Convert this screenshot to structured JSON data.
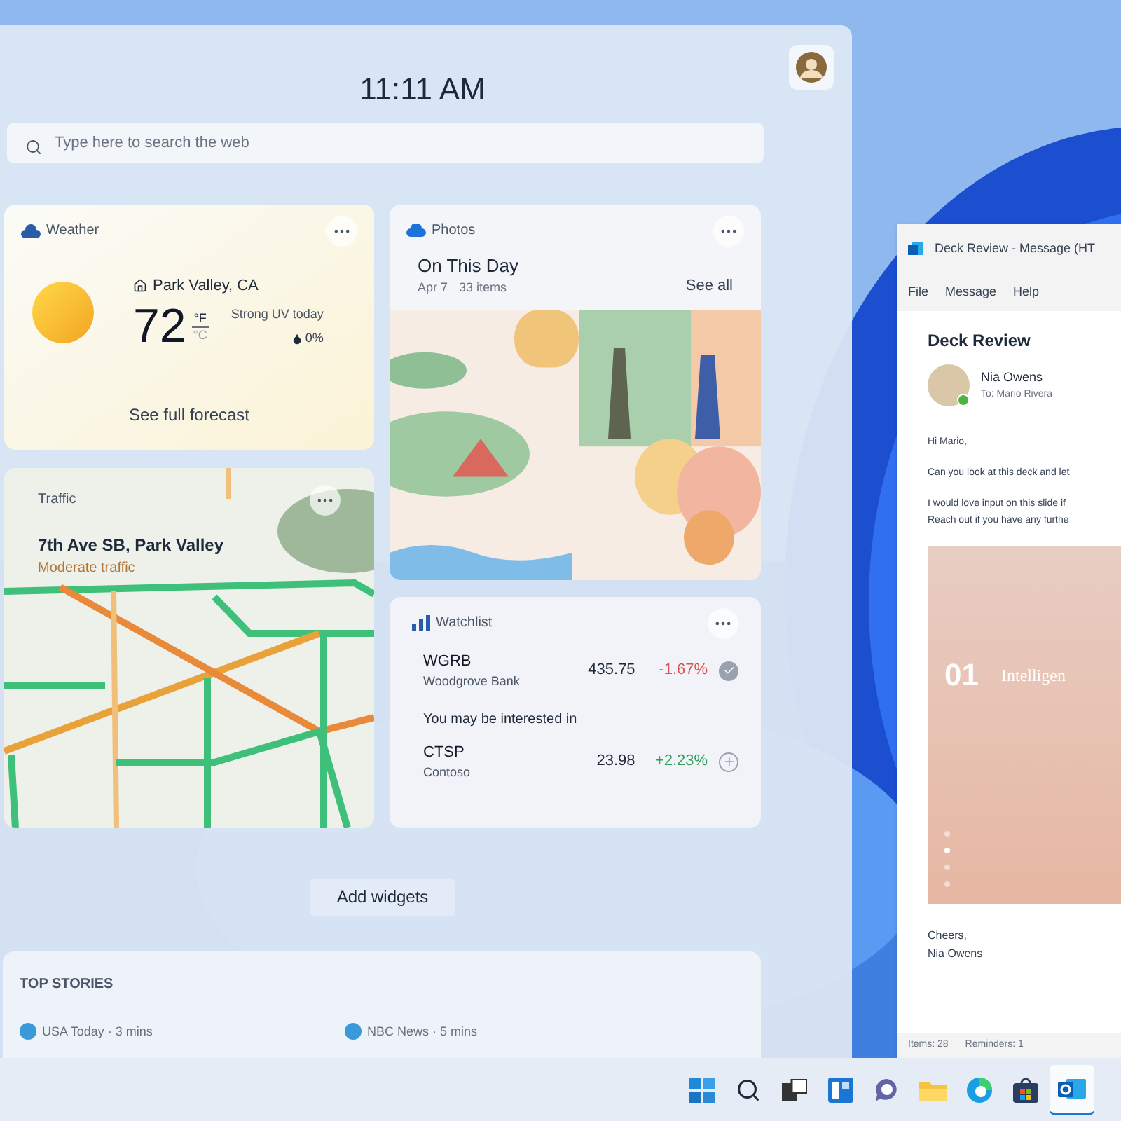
{
  "widgets_panel": {
    "time": "11:11 AM",
    "search": {
      "placeholder": "Type here to search the web"
    },
    "weather": {
      "title": "Weather",
      "location": "Park Valley, CA",
      "temperature": "72",
      "units": [
        {
          "label": "°F",
          "selected": true
        },
        {
          "label": "°C",
          "selected": false
        }
      ],
      "condition": "Strong UV today",
      "precipitation": "0%",
      "link": "See full forecast"
    },
    "traffic": {
      "title": "Traffic",
      "road": "7th Ave SB, Park Valley",
      "status": "Moderate traffic"
    },
    "photos": {
      "title": "Photos",
      "heading": "On This Day",
      "date": "Apr 7",
      "count": "33 items",
      "link": "See all"
    },
    "watchlist": {
      "title": "Watchlist",
      "stocks": [
        {
          "symbol": "WGRB",
          "name": "Woodgrove Bank",
          "price": "435.75",
          "change": "-1.67%",
          "color": "#d9534f",
          "added": true
        }
      ],
      "suggestion_heading": "You may be interested in",
      "suggestions": [
        {
          "symbol": "CTSP",
          "name": "Contoso",
          "price": "23.98",
          "change": "+2.23%",
          "color": "#2e9e5b",
          "added": false
        }
      ]
    },
    "add_widgets": "Add widgets",
    "top_stories": {
      "title": "TOP STORIES",
      "sources": [
        {
          "label": "USA Today · 3 mins"
        },
        {
          "label": "NBC News · 5 mins"
        }
      ]
    }
  },
  "mail_window": {
    "title": "Deck Review - Message (HT",
    "menu": [
      "File",
      "Message",
      "Help"
    ],
    "subject": "Deck Review",
    "sender": "Nia Owens",
    "recipient": "To: Mario Rivera",
    "online": true,
    "body": [
      "Hi Mario,",
      "Can you look at this deck and let",
      "I would love input on this slide if\nReach out if you have any furthe"
    ],
    "slide": {
      "number": "01",
      "title": "Intelligen",
      "dots": [
        {
          "selected": false
        },
        {
          "selected": true
        },
        {
          "selected": false
        },
        {
          "selected": false
        }
      ]
    },
    "signoff": "Cheers,\nNia Owens",
    "status": [
      "Items: 28",
      "Reminders: 1"
    ]
  },
  "taskbar": {
    "icons": [
      {
        "kind": "start",
        "selected": false
      },
      {
        "kind": "search",
        "selected": false
      },
      {
        "kind": "task-view",
        "selected": false
      },
      {
        "kind": "widgets",
        "selected": false
      },
      {
        "kind": "chat",
        "selected": false
      },
      {
        "kind": "explorer",
        "selected": false
      },
      {
        "kind": "edge",
        "selected": false
      },
      {
        "kind": "store",
        "selected": false
      },
      {
        "kind": "outlook",
        "selected": true
      }
    ]
  }
}
